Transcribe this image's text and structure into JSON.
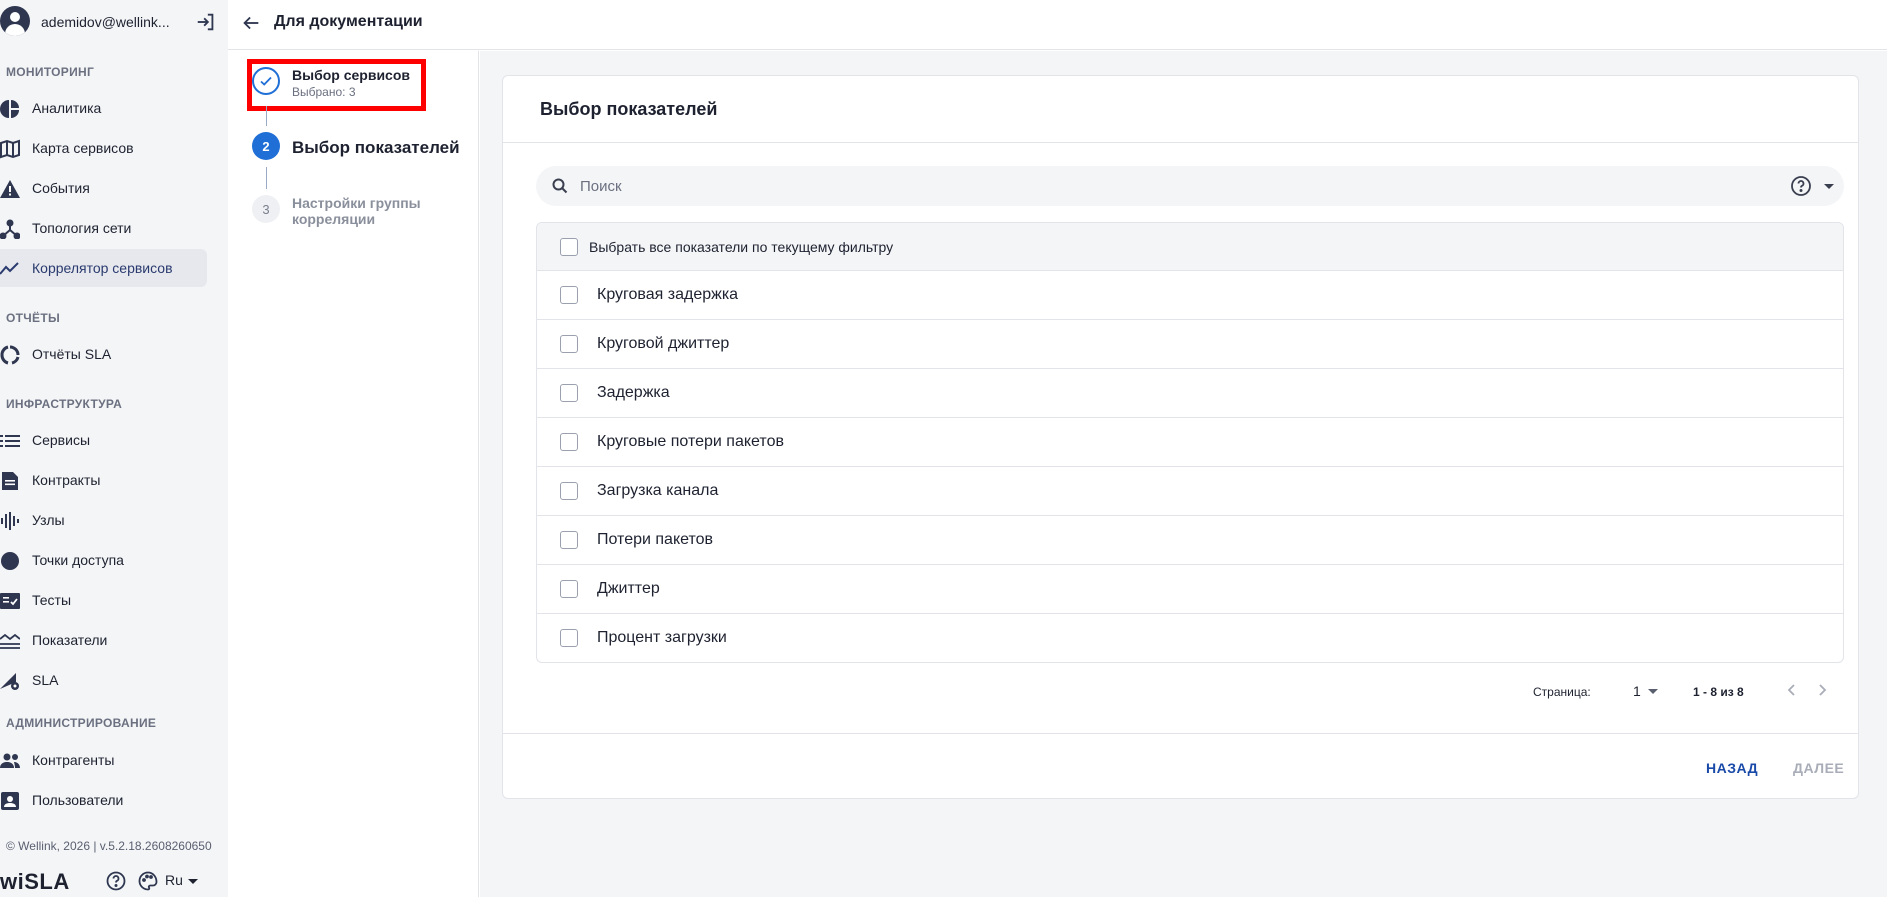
{
  "user": {
    "email": "ademidov@wellink...",
    "logout_icon": "logout-icon"
  },
  "sidebar": {
    "sections": [
      {
        "title": "МОНИТОРИНГ"
      },
      {
        "title": "ОТЧЁТЫ"
      },
      {
        "title": "ИНФРАСТРУКТУРА"
      },
      {
        "title": "АДМИНИСТРИРОВАНИЕ"
      }
    ],
    "items": [
      {
        "label": "Аналитика",
        "icon": "pie-chart-icon"
      },
      {
        "label": "Карта сервисов",
        "icon": "map-icon"
      },
      {
        "label": "События",
        "icon": "warning-icon"
      },
      {
        "label": "Топология сети",
        "icon": "topology-icon"
      },
      {
        "label": "Коррелятор сервисов",
        "icon": "trend-line-icon",
        "active": true
      },
      {
        "label": "Отчёты SLA",
        "icon": "donut-icon"
      },
      {
        "label": "Сервисы",
        "icon": "list-icon"
      },
      {
        "label": "Контракты",
        "icon": "document-icon"
      },
      {
        "label": "Узлы",
        "icon": "signal-bars-icon"
      },
      {
        "label": "Точки доступа",
        "icon": "circle-icon"
      },
      {
        "label": "Тесты",
        "icon": "checklist-icon"
      },
      {
        "label": "Показатели",
        "icon": "waves-icon"
      },
      {
        "label": "SLA",
        "icon": "sla-gear-icon"
      },
      {
        "label": "Контрагенты",
        "icon": "people-icon"
      },
      {
        "label": "Пользователи",
        "icon": "user-card-icon"
      }
    ],
    "footer": {
      "copyright": "© Wellink, 2026 | v.5.2.18.2608260650",
      "logo": "wiSLA",
      "language": "Ru"
    }
  },
  "header": {
    "title": "Для документации"
  },
  "stepper": {
    "steps": [
      {
        "number": "",
        "label": "Выбор сервисов",
        "sub": "Выбрано: 3",
        "state": "done"
      },
      {
        "number": "2",
        "label": "Выбор показателей",
        "state": "current"
      },
      {
        "number": "3",
        "label": "Настройки группы корреляции",
        "state": "todo"
      }
    ]
  },
  "main": {
    "title": "Выбор показателей",
    "search": {
      "placeholder": "Поиск",
      "value": ""
    },
    "select_all_label": "Выбрать все показатели по текущему фильтру",
    "metrics": [
      "Круговая задержка",
      "Круговой джиттер",
      "Задержка",
      "Круговые потери пакетов",
      "Загрузка канала",
      "Потери пакетов",
      "Джиттер",
      "Процент загрузки"
    ],
    "pager": {
      "label": "Страница:",
      "page": "1",
      "range": "1 - 8 из 8"
    },
    "buttons": {
      "back": "НАЗАД",
      "next": "ДАЛЕЕ"
    }
  },
  "colors": {
    "accent": "#1f6fd6",
    "highlight": "#ff0000",
    "sidebar_bg": "#f4f5f7"
  }
}
